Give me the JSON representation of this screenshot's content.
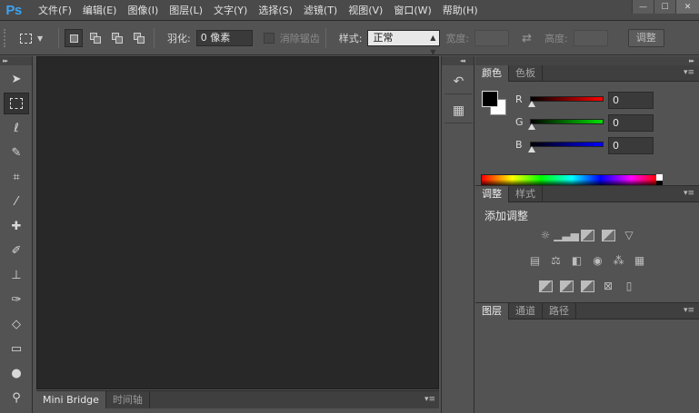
{
  "app": {
    "logo": "Ps"
  },
  "menu": [
    "文件(F)",
    "编辑(E)",
    "图像(I)",
    "图层(L)",
    "文字(Y)",
    "选择(S)",
    "滤镜(T)",
    "视图(V)",
    "窗口(W)",
    "帮助(H)"
  ],
  "window_controls": {
    "minimize": "—",
    "maximize": "☐",
    "close": "✕"
  },
  "options": {
    "feather_label": "羽化:",
    "feather_value": "0 像素",
    "antialias_label": "消除锯齿",
    "style_label": "样式:",
    "style_value": "正常",
    "width_label": "宽度:",
    "swap_glyph": "⇄",
    "height_label": "高度:",
    "adjust_button": "调整"
  },
  "tools": [
    {
      "name": "move-tool",
      "glyph": "➤"
    },
    {
      "name": "marquee-tool",
      "glyph": ""
    },
    {
      "name": "lasso-tool",
      "glyph": "ℓ"
    },
    {
      "name": "quick-select-tool",
      "glyph": "✎"
    },
    {
      "name": "crop-tool",
      "glyph": "⌗"
    },
    {
      "name": "eyedropper-tool",
      "glyph": "⁄"
    },
    {
      "name": "healing-brush-tool",
      "glyph": "✚"
    },
    {
      "name": "brush-tool",
      "glyph": "✐"
    },
    {
      "name": "clone-stamp-tool",
      "glyph": "⊥"
    },
    {
      "name": "history-brush-tool",
      "glyph": "✑"
    },
    {
      "name": "eraser-tool",
      "glyph": "◇"
    },
    {
      "name": "gradient-tool",
      "glyph": "▭"
    },
    {
      "name": "blur-tool",
      "glyph": "●"
    },
    {
      "name": "dodge-tool",
      "glyph": "⚲"
    }
  ],
  "bottom_tabs": {
    "mini_bridge": "Mini Bridge",
    "timeline": "时间轴"
  },
  "panel_menu_glyph": "▾≡",
  "collapse_glyph": "◂◂",
  "expand_glyph": "▸▸",
  "color_panel": {
    "tab_color": "颜色",
    "tab_swatches": "色板",
    "channels": [
      {
        "label": "R",
        "value": "0",
        "color": "#ff0000"
      },
      {
        "label": "G",
        "value": "0",
        "color": "#00e000"
      },
      {
        "label": "B",
        "value": "0",
        "color": "#0000ff"
      }
    ]
  },
  "adjustments_panel": {
    "tab_adjust": "调整",
    "tab_styles": "样式",
    "title": "添加调整"
  },
  "layers_panel": {
    "tab_layers": "图层",
    "tab_channels": "通道",
    "tab_paths": "路径"
  }
}
